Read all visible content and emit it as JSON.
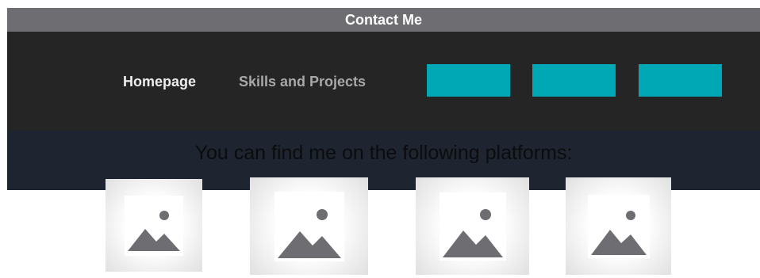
{
  "header": {
    "title": "Contact Me"
  },
  "nav": {
    "links": [
      {
        "label": "Homepage"
      },
      {
        "label": "Skills and Projects"
      }
    ],
    "buttons": [
      {
        "label": ""
      },
      {
        "label": ""
      },
      {
        "label": ""
      }
    ],
    "button_color": "#00a8b5",
    "background_color": "#252525"
  },
  "main": {
    "intro_text": "You can find me on the following platforms:",
    "platforms": [
      {
        "icon": "image-placeholder-icon"
      },
      {
        "icon": "image-placeholder-icon"
      },
      {
        "icon": "image-placeholder-icon"
      },
      {
        "icon": "image-placeholder-icon"
      }
    ]
  }
}
